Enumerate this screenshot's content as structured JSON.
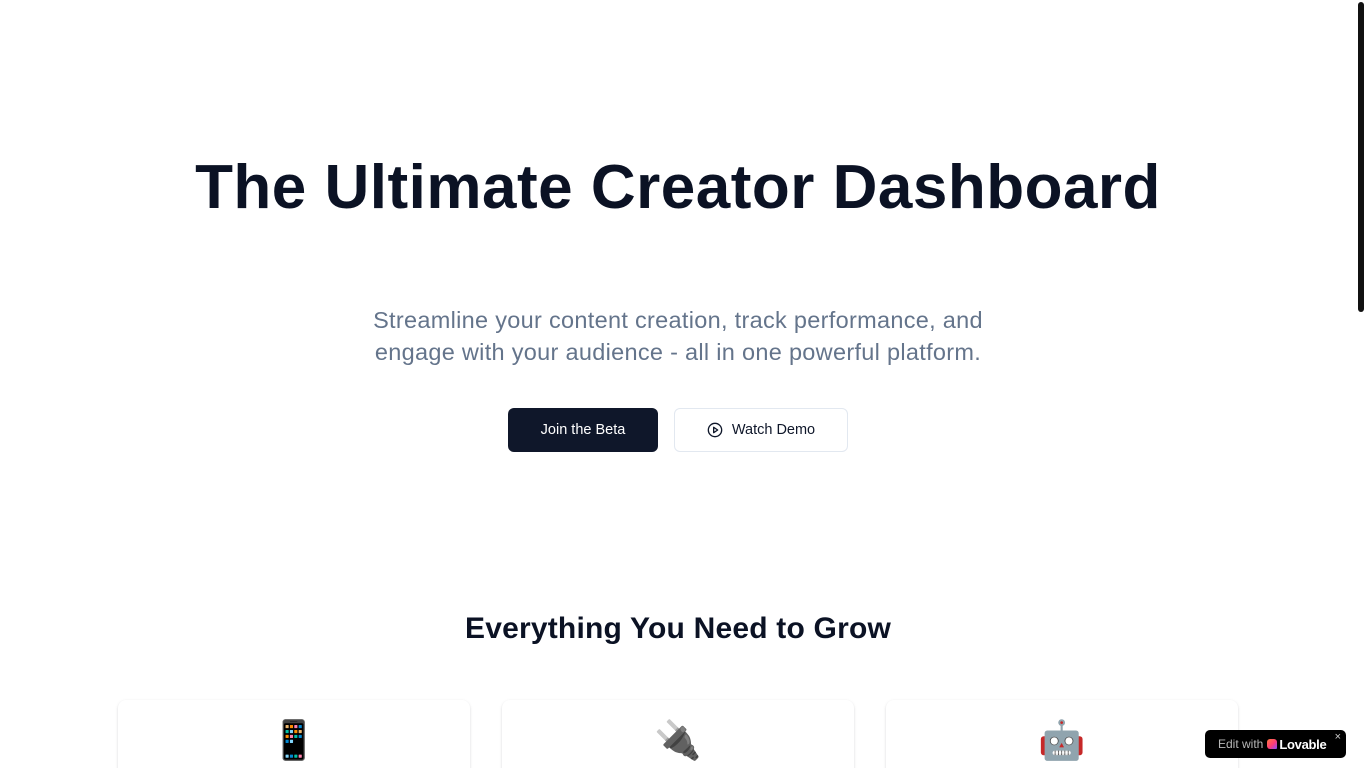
{
  "hero": {
    "title": "The Ultimate Creator Dashboard",
    "subtitle": "Streamline your content creation, track performance, and engage with your audience - all in one powerful platform.",
    "primary_cta": "Join the Beta",
    "secondary_cta": "Watch Demo",
    "secondary_cta_icon": "play-circle-icon"
  },
  "features": {
    "title": "Everything You Need to Grow",
    "cards": [
      {
        "icon": "📱",
        "icon_name": "mobile-phone-icon"
      },
      {
        "icon": "🔌",
        "icon_name": "electric-plug-icon"
      },
      {
        "icon": "🤖",
        "icon_name": "robot-icon"
      }
    ]
  },
  "badge": {
    "prefix": "Edit with",
    "brand": "Lovable",
    "close": "×"
  },
  "colors": {
    "primary": "#0f172a",
    "muted_text": "#64748b",
    "border": "#e2e8f0",
    "background": "#ffffff"
  }
}
